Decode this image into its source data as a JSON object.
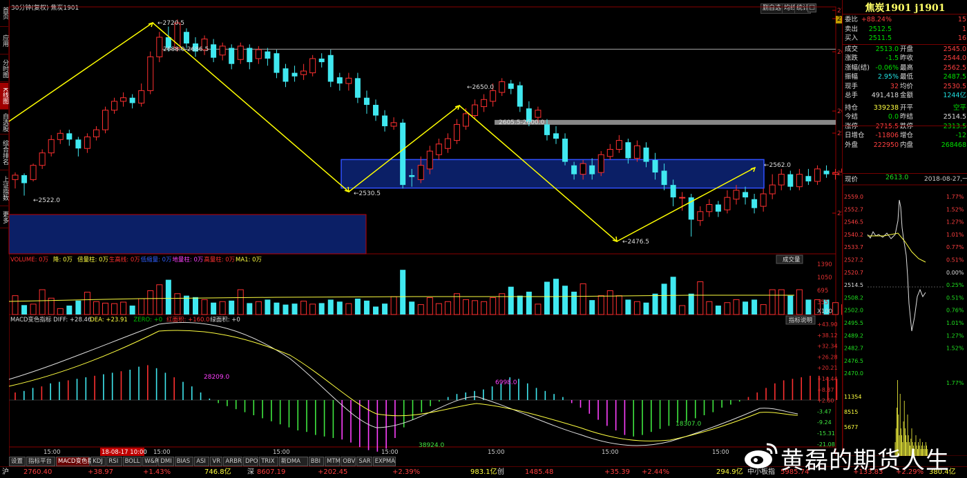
{
  "app": {
    "period_label": "30分钟(复权)",
    "symbol_title": "焦炭1901",
    "title_buttons": [
      "删自选",
      "均线",
      "统计"
    ],
    "watermark": "黄磊的期货人生"
  },
  "left_sidebar": [
    {
      "label": "首页"
    },
    {
      "label": "应用"
    },
    {
      "label": "分时图"
    },
    {
      "label": "K线图",
      "active": true
    },
    {
      "label": "自选股"
    },
    {
      "label": "综合排名"
    },
    {
      "label": "上证指数"
    },
    {
      "label": "更多"
    }
  ],
  "main_chart": {
    "price_axis": [
      "2734.1",
      "2724.5",
      "2688.9",
      "2643.7",
      "2598.5",
      "2553.3",
      "2508.1"
    ],
    "annotations": [
      "2720.5",
      "2688.0-2686.5",
      "2650.0",
      "2605.5-2600.0",
      "2562.0",
      "2530.5",
      "2522.0",
      "2476.5"
    ]
  },
  "volume_panel": {
    "legend": [
      {
        "text": "VOLUME: 0万",
        "color": "#ff3030"
      },
      {
        "text": "降: 0万",
        "color": "#ffff40"
      },
      {
        "text": "倍量柱: 0万",
        "color": "#ffff40"
      },
      {
        "text": "生高线: 0万",
        "color": "#ff3030"
      },
      {
        "text": "低缩量: 0万",
        "color": "#3060ff"
      },
      {
        "text": "地量柱: 0万",
        "color": "#ff40ff"
      },
      {
        "text": "高量柱: 0万",
        "color": "#ff3030"
      },
      {
        "text": "MA1: 0万",
        "color": "#ffff40"
      }
    ],
    "button": "成交量",
    "axis": [
      "1390",
      "1050",
      "695",
      "355",
      "X100"
    ]
  },
  "macd_panel": {
    "legend": [
      {
        "text": "MACD变色指标 DIFF: +28.46",
        "color": "#ddd"
      },
      {
        "text": "DEA: +23.91",
        "color": "#ffff40"
      },
      {
        "text": "ZERO: +0",
        "color": "#00c000"
      },
      {
        "text": "红面积: +160.0",
        "color": "#ff3030"
      },
      {
        "text": "绿面积: +0",
        "color": "#ddd"
      }
    ],
    "button": "指标说明",
    "axis": [
      "+43.90",
      "+38.12",
      "+32.34",
      "+26.28",
      "+20.21",
      "+14.44",
      "+8.37",
      "+2.60",
      "-3.47",
      "-9.24",
      "-15.31",
      "-21.08"
    ],
    "labels": [
      "28209.0",
      "6998.0",
      "18307.0",
      "38924.0"
    ]
  },
  "time_axis": [
    "15:00",
    "18-08-17 10:00",
    "15:00",
    "15:00",
    "15:00",
    "15:00",
    "15:00",
    "15:00"
  ],
  "quote": {
    "title": "焦炭1901 j1901",
    "rows": [
      {
        "l1": "委比",
        "v1": "+88.24%",
        "c1": "red",
        "l2": "",
        "v2": "15",
        "c2": "red"
      },
      {
        "l1": "卖出",
        "v1": "2512.5",
        "c1": "green",
        "l2": "",
        "v2": "1",
        "c2": "red"
      },
      {
        "l1": "买入",
        "v1": "2511.5",
        "c1": "green",
        "l2": "",
        "v2": "16",
        "c2": "red"
      },
      {
        "l1": "成交",
        "v1": "2513.0",
        "c1": "green",
        "l2": "开盘",
        "v2": "2545.0",
        "c2": "red"
      },
      {
        "l1": "涨跌",
        "v1": "-1.5",
        "c1": "green",
        "l2": "昨收",
        "v2": "2544.0",
        "c2": "red"
      },
      {
        "l1": "涨幅(结)",
        "v1": "-0.06%",
        "c1": "green",
        "l2": "最高",
        "v2": "2562.5",
        "c2": "red"
      },
      {
        "l1": "振幅",
        "v1": "2.95%",
        "c1": "cyan",
        "l2": "最低",
        "v2": "2487.5",
        "c2": "green"
      },
      {
        "l1": "现手",
        "v1": "32",
        "c1": "red",
        "l2": "均价",
        "v2": "2530.5",
        "c2": "red"
      },
      {
        "l1": "总手",
        "v1": "491,418",
        "c1": "white",
        "l2": "金额",
        "v2": "1244亿",
        "c2": "cyan"
      },
      {
        "l1": "持仓",
        "v1": "339238",
        "c1": "yel",
        "l2": "开平",
        "v2": "空平",
        "c2": "green"
      },
      {
        "l1": "今结",
        "v1": "0.0",
        "c1": "green",
        "l2": "昨结",
        "v2": "2514.5",
        "c2": "white"
      },
      {
        "l1": "涨停",
        "v1": "2715.5",
        "c1": "red",
        "l2": "跌停",
        "v2": "2313.5",
        "c2": "green"
      },
      {
        "l1": "日增仓",
        "v1": "-11806",
        "c1": "red",
        "l2": "增仓",
        "v2": "-12",
        "c2": "green"
      },
      {
        "l1": "外盘",
        "v1": "222950",
        "c1": "red",
        "l2": "内盘",
        "v2": "268468",
        "c2": "green"
      }
    ],
    "price_label": "现价",
    "price_value": "2613.0",
    "date": "2018-08-27,一",
    "mini_left_axis": [
      "2559.0",
      "2552.7",
      "2546.5",
      "2540.2",
      "2533.7",
      "2527.2",
      "2520.7",
      "2514.5",
      "2508.2",
      "2502.0",
      "2495.5",
      "2489.2",
      "2482.7",
      "2476.5",
      "2470.0",
      "11354",
      "8515",
      "5677"
    ],
    "mini_right_axis": [
      "1.77%",
      "1.52%",
      "1.27%",
      "1.01%",
      "0.77%",
      "0.51%",
      "0.00%",
      "0.25%",
      "0.51%",
      "0.76%",
      "1.01%",
      "1.27%",
      "1.52%",
      "1.77%"
    ]
  },
  "bottom_tabs": [
    "设置",
    "指标平台",
    "MACD变色指标",
    "KDJ",
    "RSI",
    "BOLL",
    "W&R",
    "DMI",
    "BIAS",
    "ASI",
    "VR",
    "ARBR",
    "DPO",
    "TRIX",
    "新DMA",
    "BBI",
    "MTM",
    "OBV",
    "SAR",
    "EXPMA"
  ],
  "status_bar": [
    {
      "text": "沪",
      "color": "#ddd"
    },
    {
      "text": "2760.40",
      "color": "#ff4040"
    },
    {
      "text": "+38.97",
      "color": "#ff4040"
    },
    {
      "text": "+1.43%",
      "color": "#ff4040"
    },
    {
      "text": "746.8亿",
      "color": "#ffff40"
    },
    {
      "text": "深",
      "color": "#ddd"
    },
    {
      "text": "8607.19",
      "color": "#ff4040"
    },
    {
      "text": "+202.45",
      "color": "#ff4040"
    },
    {
      "text": "+2.39%",
      "color": "#ff4040"
    },
    {
      "text": "983.1亿",
      "color": "#ffff40"
    },
    {
      "text": "创",
      "color": "#ddd"
    },
    {
      "text": "1485.48",
      "color": "#ff4040"
    },
    {
      "text": "+35.39",
      "color": "#ff4040"
    },
    {
      "text": "+2.44%",
      "color": "#ff4040"
    },
    {
      "text": "294.9亿",
      "color": "#ffff40"
    },
    {
      "text": "中小板指",
      "color": "#ddd"
    },
    {
      "text": "5985.74",
      "color": "#ff4040"
    },
    {
      "text": "+133.83",
      "color": "#ff4040"
    },
    {
      "text": "+2.29%",
      "color": "#ff4040"
    },
    {
      "text": "380.4亿",
      "color": "#ffff40"
    }
  ]
}
